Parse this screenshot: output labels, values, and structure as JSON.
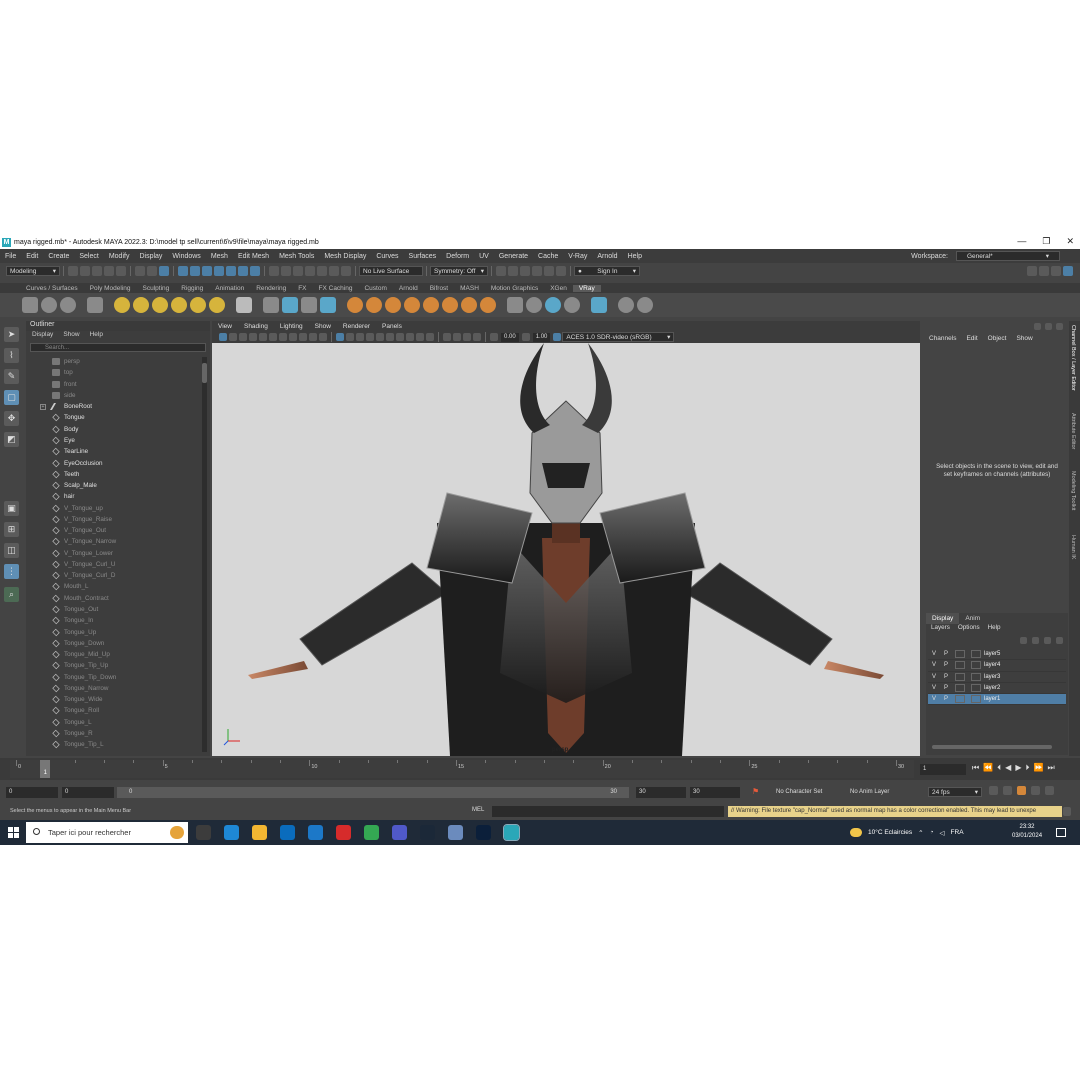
{
  "window": {
    "title": "maya rigged.mb* - Autodesk MAYA 2022.3: D:\\model tp sell\\current\\6\\v9\\file\\maya\\maya rigged.mb",
    "controls": [
      "—",
      "❐",
      "✕"
    ]
  },
  "menubar": {
    "items": [
      "File",
      "Edit",
      "Create",
      "Select",
      "Modify",
      "Display",
      "Windows",
      "Mesh",
      "Edit Mesh",
      "Mesh Tools",
      "Mesh Display",
      "Curves",
      "Surfaces",
      "Deform",
      "UV",
      "Generate",
      "Cache",
      "V-Ray",
      "Arnold",
      "Help"
    ],
    "workspace_label": "Workspace:",
    "workspace_value": "General*"
  },
  "statusline": {
    "mode": "Modeling",
    "live_surface": "No Live Surface",
    "symmetry": "Symmetry: Off",
    "sign_in": "Sign In"
  },
  "shelf": {
    "tabs": [
      "Curves / Surfaces",
      "Poly Modeling",
      "Sculpting",
      "Rigging",
      "Animation",
      "Rendering",
      "FX",
      "FX Caching",
      "Custom",
      "Arnold",
      "Bifrost",
      "MASH",
      "Motion Graphics",
      "XGen",
      "VRay"
    ],
    "active_tab": "VRay"
  },
  "outliner": {
    "title": "Outliner",
    "menus": [
      "Display",
      "Show",
      "Help"
    ],
    "search_placeholder": "Search...",
    "items": [
      {
        "label": "persp",
        "dim": true,
        "icon": "camera-icon"
      },
      {
        "label": "top",
        "dim": true,
        "icon": "camera-icon"
      },
      {
        "label": "front",
        "dim": true,
        "icon": "camera-icon"
      },
      {
        "label": "side",
        "dim": true,
        "icon": "camera-icon"
      },
      {
        "label": "BoneRoot",
        "dim": false,
        "icon": "joint-icon",
        "expandable": true
      },
      {
        "label": "Tongue",
        "dim": false,
        "icon": "mesh-icon"
      },
      {
        "label": "Body",
        "dim": false,
        "icon": "mesh-icon"
      },
      {
        "label": "Eye",
        "dim": false,
        "icon": "mesh-icon"
      },
      {
        "label": "TearLine",
        "dim": false,
        "icon": "mesh-icon"
      },
      {
        "label": "EyeOcclusion",
        "dim": false,
        "icon": "mesh-icon"
      },
      {
        "label": "Teeth",
        "dim": false,
        "icon": "mesh-icon"
      },
      {
        "label": "Scalp_Male",
        "dim": false,
        "icon": "mesh-icon"
      },
      {
        "label": "hair",
        "dim": false,
        "icon": "mesh-icon"
      },
      {
        "label": "V_Tongue_up",
        "dim": true,
        "icon": "mesh-icon"
      },
      {
        "label": "V_Tongue_Raise",
        "dim": true,
        "icon": "mesh-icon"
      },
      {
        "label": "V_Tongue_Out",
        "dim": true,
        "icon": "mesh-icon"
      },
      {
        "label": "V_Tongue_Narrow",
        "dim": true,
        "icon": "mesh-icon"
      },
      {
        "label": "V_Tongue_Lower",
        "dim": true,
        "icon": "mesh-icon"
      },
      {
        "label": "V_Tongue_Curl_U",
        "dim": true,
        "icon": "mesh-icon"
      },
      {
        "label": "V_Tongue_Curl_D",
        "dim": true,
        "icon": "mesh-icon"
      },
      {
        "label": "Mouth_L",
        "dim": true,
        "icon": "mesh-icon"
      },
      {
        "label": "Mouth_Contract",
        "dim": true,
        "icon": "mesh-icon"
      },
      {
        "label": "Tongue_Out",
        "dim": true,
        "icon": "mesh-icon"
      },
      {
        "label": "Tongue_In",
        "dim": true,
        "icon": "mesh-icon"
      },
      {
        "label": "Tongue_Up",
        "dim": true,
        "icon": "mesh-icon"
      },
      {
        "label": "Tongue_Down",
        "dim": true,
        "icon": "mesh-icon"
      },
      {
        "label": "Tongue_Mid_Up",
        "dim": true,
        "icon": "mesh-icon"
      },
      {
        "label": "Tongue_Tip_Up",
        "dim": true,
        "icon": "mesh-icon"
      },
      {
        "label": "Tongue_Tip_Down",
        "dim": true,
        "icon": "mesh-icon"
      },
      {
        "label": "Tongue_Narrow",
        "dim": true,
        "icon": "mesh-icon"
      },
      {
        "label": "Tongue_Wide",
        "dim": true,
        "icon": "mesh-icon"
      },
      {
        "label": "Tongue_Roll",
        "dim": true,
        "icon": "mesh-icon"
      },
      {
        "label": "Tongue_L",
        "dim": true,
        "icon": "mesh-icon"
      },
      {
        "label": "Tongue_R",
        "dim": true,
        "icon": "mesh-icon"
      },
      {
        "label": "Tongue_Tip_L",
        "dim": true,
        "icon": "mesh-icon"
      }
    ]
  },
  "viewport": {
    "menus": [
      "View",
      "Shading",
      "Lighting",
      "Show",
      "Renderer",
      "Panels"
    ],
    "exposure": "0.00",
    "gamma": "1.00",
    "color_space": "ACES 1.0 SDR-video (sRGB)",
    "camera_label": "persp"
  },
  "channelbox": {
    "menus": [
      "Channels",
      "Edit",
      "Object",
      "Show"
    ],
    "message": "Select objects in the scene to view, edit and set keyframes on channels (attributes)",
    "side_tabs": [
      "Channel Box / Layer Editor",
      "Attribute Editor",
      "Modeling Toolkit",
      "Human IK"
    ]
  },
  "layer_editor": {
    "tabs": [
      "Display",
      "Anim"
    ],
    "active_tab": "Display",
    "menus": [
      "Layers",
      "Options",
      "Help"
    ],
    "layers": [
      {
        "v": "V",
        "p": "P",
        "name": "layer5",
        "selected": false
      },
      {
        "v": "V",
        "p": "P",
        "name": "layer4",
        "selected": false
      },
      {
        "v": "V",
        "p": "P",
        "name": "layer3",
        "selected": false
      },
      {
        "v": "V",
        "p": "P",
        "name": "layer2",
        "selected": false
      },
      {
        "v": "V",
        "p": "P",
        "name": "layer1",
        "selected": true
      }
    ]
  },
  "timeline": {
    "tick_labels": [
      "0",
      "5",
      "10",
      "15",
      "20",
      "25",
      "30"
    ],
    "current_frame": "1",
    "frame_field": "1",
    "playback_controls": [
      "⏮",
      "⏪",
      "⏴",
      "◀",
      "▶",
      "⏵",
      "⏩",
      "⏭"
    ]
  },
  "range": {
    "start": "0",
    "anim_start": "0",
    "slider_start": "0",
    "slider_end": "30",
    "anim_end": "30",
    "end": "30",
    "character_set": "No Character Set",
    "anim_layer": "No Anim Layer",
    "fps": "24 fps"
  },
  "commandline": {
    "help_text": "Select the menus to appear in the Main Menu Bar",
    "mel_label": "MEL",
    "warning": "// Warning: File texture \"cap_Normal\" used as normal map has a color correction enabled. This may lead to unexpe"
  },
  "taskbar": {
    "search_placeholder": "Taper ici pour rechercher",
    "weather": "10°C  Eclaircies",
    "language": "FRA",
    "time": "23:32",
    "date": "03/01/2024",
    "app_colors": [
      "#3c3c3c",
      "#1e88d6",
      "#f2b632",
      "#0a6cbd",
      "#1c78c8",
      "#d62b2b",
      "#34a853",
      "#5059c9",
      "#1b2838",
      "#6b8bbd",
      "#0b1f3a",
      "#2aa7b8"
    ]
  },
  "colors": {
    "accent_blue": "#4f7ea6",
    "maya_teal": "#2aa7b8",
    "viewport_bg": "#d7d7d7",
    "warning_bg": "#e8d28a"
  }
}
